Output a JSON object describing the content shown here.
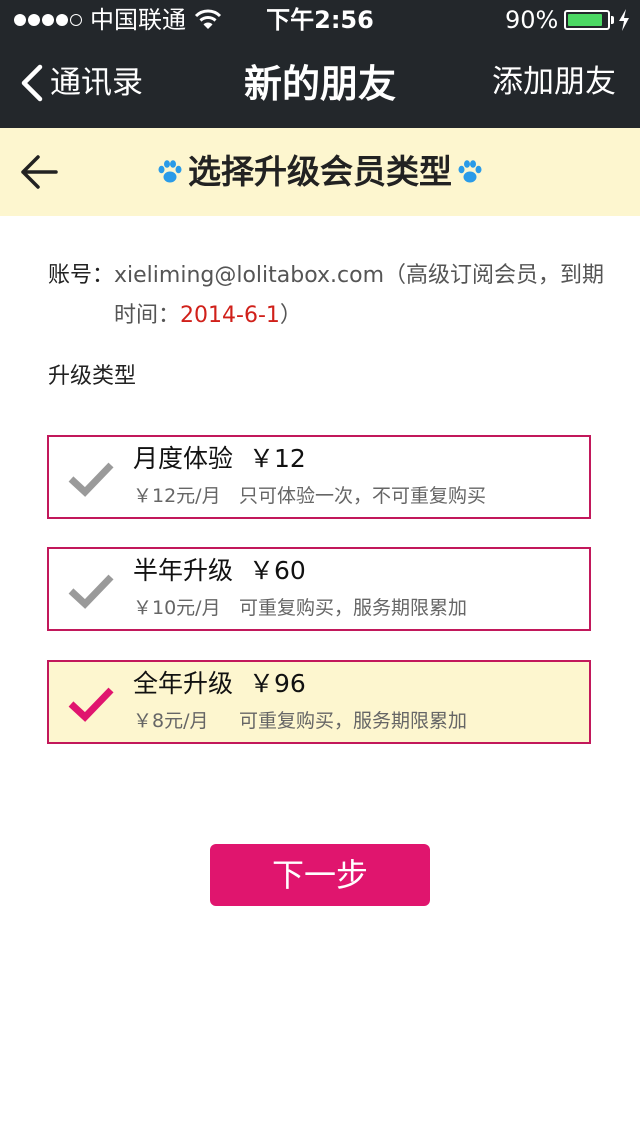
{
  "status_bar": {
    "carrier": "中国联通",
    "time": "下午2:56",
    "battery_percent_text": "90%",
    "battery_level": 0.9,
    "signal_bars": 4,
    "signal_total": 5
  },
  "nav": {
    "back_label": "通讯录",
    "title": "新的朋友",
    "right_label": "添加朋友"
  },
  "page": {
    "title": "选择升级会员类型",
    "paw_color": "#2a9be8"
  },
  "account": {
    "label": "账号：",
    "email": "xieliming@lolitabox.com",
    "membership_prefix": "（高级订阅会员，到期",
    "expiry_label": "时间：",
    "expiry_date": "2014-6-1",
    "close_paren": "）"
  },
  "upgrade": {
    "section_title": "升级类型",
    "options": [
      {
        "name": "月度体验",
        "price": "￥12",
        "unit_price": "￥12元/月",
        "note": "只可体验一次，不可重复购买",
        "selected": false
      },
      {
        "name": "半年升级",
        "price": "￥60",
        "unit_price": "￥10元/月",
        "note": "可重复购买，服务期限累加",
        "selected": false
      },
      {
        "name": "全年升级",
        "price": "￥96",
        "unit_price": "￥8元/月",
        "note": "可重复购买，服务期限累加",
        "selected": true
      }
    ]
  },
  "next_button": "下一步",
  "colors": {
    "accent": "#e0156e",
    "border": "#c2185b",
    "highlight_bg": "#fdf6cf",
    "date_red": "#d0201a",
    "check_gray": "#9a9a9a",
    "nav_bg": "#23272b",
    "battery_green": "#4cd964"
  }
}
